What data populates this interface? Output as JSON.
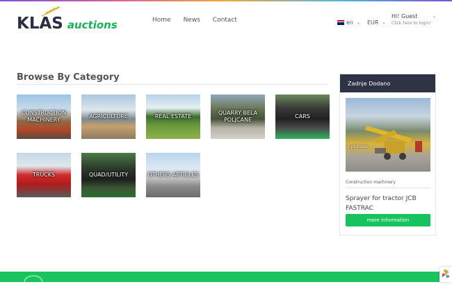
{
  "header": {
    "logo_main": "KLAS",
    "logo_sub": "auctions",
    "nav": [
      "Home",
      "News",
      "Contact"
    ],
    "language": "en",
    "currency": "EUR",
    "user_greeting": "Hi! Guest",
    "user_login": "Click here to login!"
  },
  "main": {
    "title": "Browse By Category",
    "categories": [
      {
        "label": "CONSTRUCTION MACHINERY"
      },
      {
        "label": "AGRICULTURE"
      },
      {
        "label": "REAL ESTATE"
      },
      {
        "label": "QUARRY BELA POLJCANE"
      },
      {
        "label": "CARS"
      },
      {
        "label": "TRUCKS"
      },
      {
        "label": "QUAD/UTILITY"
      },
      {
        "label": "OTHERS ARTICLES"
      }
    ]
  },
  "sidebar": {
    "heading": "Zadnje Dodano",
    "pictures": "3 pictures",
    "category": "Construction machinery",
    "title": "Sprayer for tractor JCB FASTRAC",
    "button": "more information"
  },
  "colors": {
    "brand_green": "#17c35f",
    "dark_navy": "#2e3346",
    "logo_text": "#2a2f45"
  }
}
